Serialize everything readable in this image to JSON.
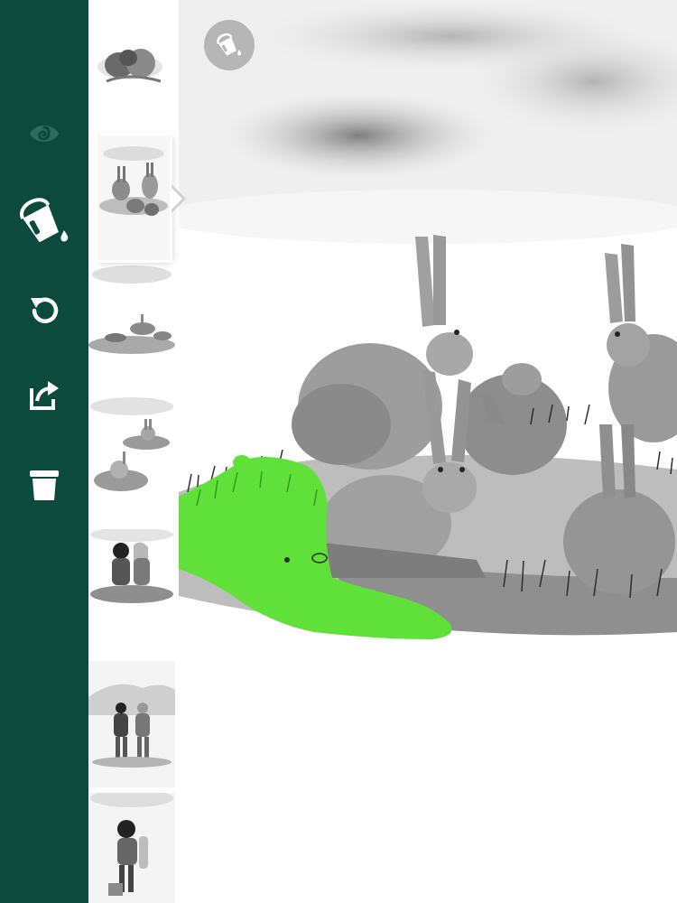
{
  "theme": {
    "toolbar_bg": "#0b4a3c",
    "icon_active": "#ffffff",
    "icon_dim": "#2f6a5b",
    "paint_green": "#5fe13a",
    "fab_bg": "#b6b6b6"
  },
  "toolbar": {
    "items": [
      {
        "icon": "swirl-icon",
        "state": "disabled"
      },
      {
        "icon": "paint-bucket-icon",
        "state": "selected"
      },
      {
        "icon": "undo-icon",
        "state": "enabled"
      },
      {
        "icon": "share-icon",
        "state": "enabled"
      },
      {
        "icon": "trash-icon",
        "state": "enabled"
      }
    ]
  },
  "thumbnails": {
    "count": 7,
    "selected_index": 1,
    "subjects": [
      "rabbits-group",
      "hares-on-hill",
      "hares-in-grass",
      "hares-on-mound",
      "children-hugging",
      "children-waving",
      "child-standing"
    ]
  },
  "canvas": {
    "fill_tool_icon": "paint-bucket-icon",
    "fill_color": "#5fe13a"
  }
}
